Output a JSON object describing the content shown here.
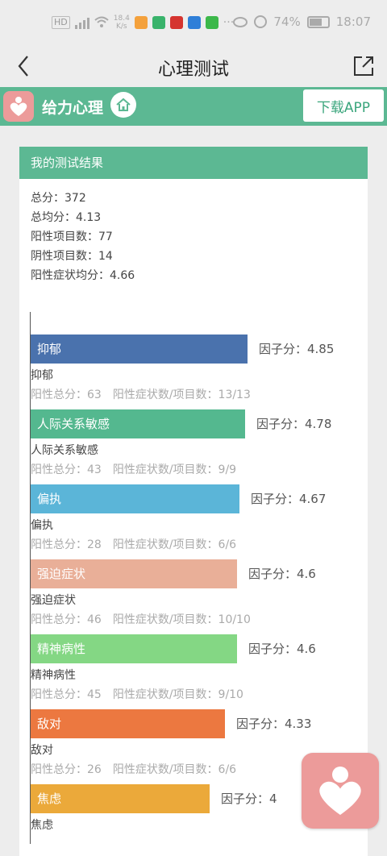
{
  "status_bar": {
    "net_speed_1": "18.4",
    "net_speed_2": "K/s",
    "battery": "74%",
    "time": "18:07"
  },
  "nav": {
    "title": "心理测试"
  },
  "banner": {
    "brand": "给力心理",
    "download": "下载APP"
  },
  "result": {
    "title": "我的测试结果",
    "summary": [
      "总分：372",
      "总均分：4.13",
      "阳性项目数：77",
      "阴性项目数：14",
      "阳性症状均分：4.66"
    ]
  },
  "chart_data": {
    "type": "bar",
    "orientation": "horizontal",
    "xlim": [
      0,
      5.4
    ],
    "items": [
      {
        "name": "抑郁",
        "value": 4.85,
        "factor_label": "因子分：4.85",
        "color": "#4a72ad",
        "detail": "阳性总分：63　阳性症状数/项目数：13/13"
      },
      {
        "name": "人际关系敏感",
        "value": 4.78,
        "factor_label": "因子分：4.78",
        "color": "#54b88f",
        "detail": "阳性总分：43　阳性症状数/项目数：9/9"
      },
      {
        "name": "偏执",
        "value": 4.67,
        "factor_label": "因子分：4.67",
        "color": "#5bb5d8",
        "detail": "阳性总分：28　阳性症状数/项目数：6/6"
      },
      {
        "name": "强迫症状",
        "value": 4.6,
        "factor_label": "因子分：4.6",
        "color": "#e9af98",
        "detail": "阳性总分：46　阳性症状数/项目数：10/10"
      },
      {
        "name": "精神病性",
        "value": 4.6,
        "factor_label": "因子分：4.6",
        "color": "#84d784",
        "detail": "阳性总分：45　阳性症状数/项目数：9/10"
      },
      {
        "name": "敌对",
        "value": 4.33,
        "factor_label": "因子分：4.33",
        "color": "#ec7840",
        "detail": "阳性总分：26　阳性症状数/项目数：6/6"
      },
      {
        "name": "焦虑",
        "value": 4,
        "factor_label": "因子分：4",
        "color": "#eba93a",
        "detail": ""
      }
    ]
  }
}
